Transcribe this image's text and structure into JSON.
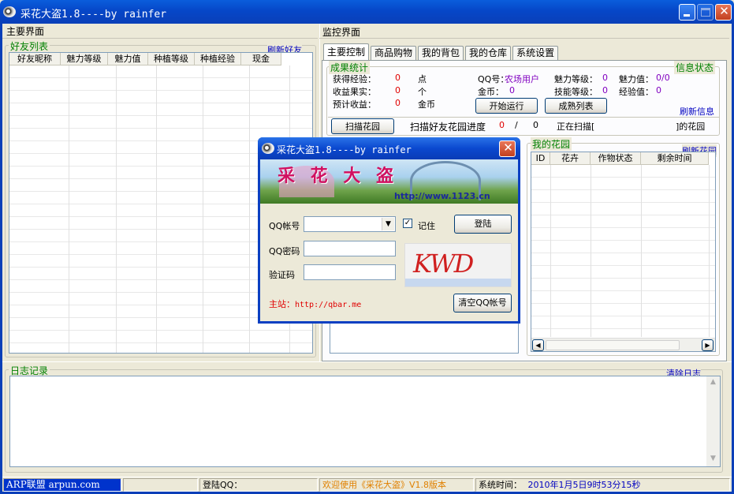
{
  "window": {
    "title": "采花大盗1.8----by rainfer"
  },
  "left_panel": {
    "header": "主要界面",
    "friends_group": "好友列表",
    "refresh_friends": "刷新好友",
    "columns": [
      "好友昵称",
      "魅力等级",
      "魅力值",
      "种植等级",
      "种植经验",
      "现金"
    ]
  },
  "right_panel": {
    "header": "监控界面",
    "tabs": [
      "主要控制",
      "商品购物",
      "我的背包",
      "我的仓库",
      "系统设置"
    ],
    "stats_group": "成果统计",
    "info_status": "信息状态",
    "refresh_info": "刷新信息",
    "stats": {
      "exp_label": "获得经验：",
      "exp_value": "0",
      "exp_unit": "点",
      "harvest_label": "收益果实：",
      "harvest_value": "0",
      "harvest_unit": "个",
      "expect_label": "预计收益：",
      "expect_value": "0",
      "expect_unit": "金币"
    },
    "info": {
      "qq_label": "QQ号：",
      "qq_value": "农场用户",
      "coin_label": "金币：",
      "coin_value": "0",
      "charm_level_label": "魅力等级：",
      "charm_level_value": "0",
      "charm_value_label": "魅力值：",
      "charm_value_value": "0/0",
      "skill_level_label": "技能等级：",
      "skill_level_value": "0",
      "exp_label": "经验值：",
      "exp_value": "0"
    },
    "start_button": "开始运行",
    "mature_button": "成熟列表",
    "scan_button": "扫描花园",
    "scan_progress_label": "扫描好友花园进度",
    "scan_current": "0",
    "scan_sep": "/",
    "scan_total": "0",
    "scanning_label": "正在扫描[",
    "scanning_suffix": "]的花园",
    "garden_group": "我的花园",
    "refresh_garden": "刷新花园",
    "garden_columns": [
      "ID",
      "花卉",
      "作物状态",
      "剩余时间"
    ]
  },
  "log": {
    "group": "日志记录",
    "clear": "清除日志"
  },
  "statusbar": {
    "brand": "ARP联盟 arpun.com",
    "login_qq": "登陆QQ：",
    "welcome": "欢迎使用《采花大盗》V1.8版本",
    "time_label": "系统时间：",
    "time_value": "2010年1月5日9时53分15秒"
  },
  "login_dialog": {
    "title": "采花大盗1.8----by rainfer",
    "banner_text": "采 花 大 盗",
    "banner_url": "http://www.1123.cn",
    "account_label": "QQ帐号",
    "account_value": "",
    "remember_label": "记住",
    "remember_checked": true,
    "login_button": "登陆",
    "password_label": "QQ密码",
    "captcha_label": "验证码",
    "captcha_image_text": "KWD",
    "site_label": "主站：",
    "site_url": "http://qbar.me",
    "clear_button": "清空QQ帐号"
  }
}
